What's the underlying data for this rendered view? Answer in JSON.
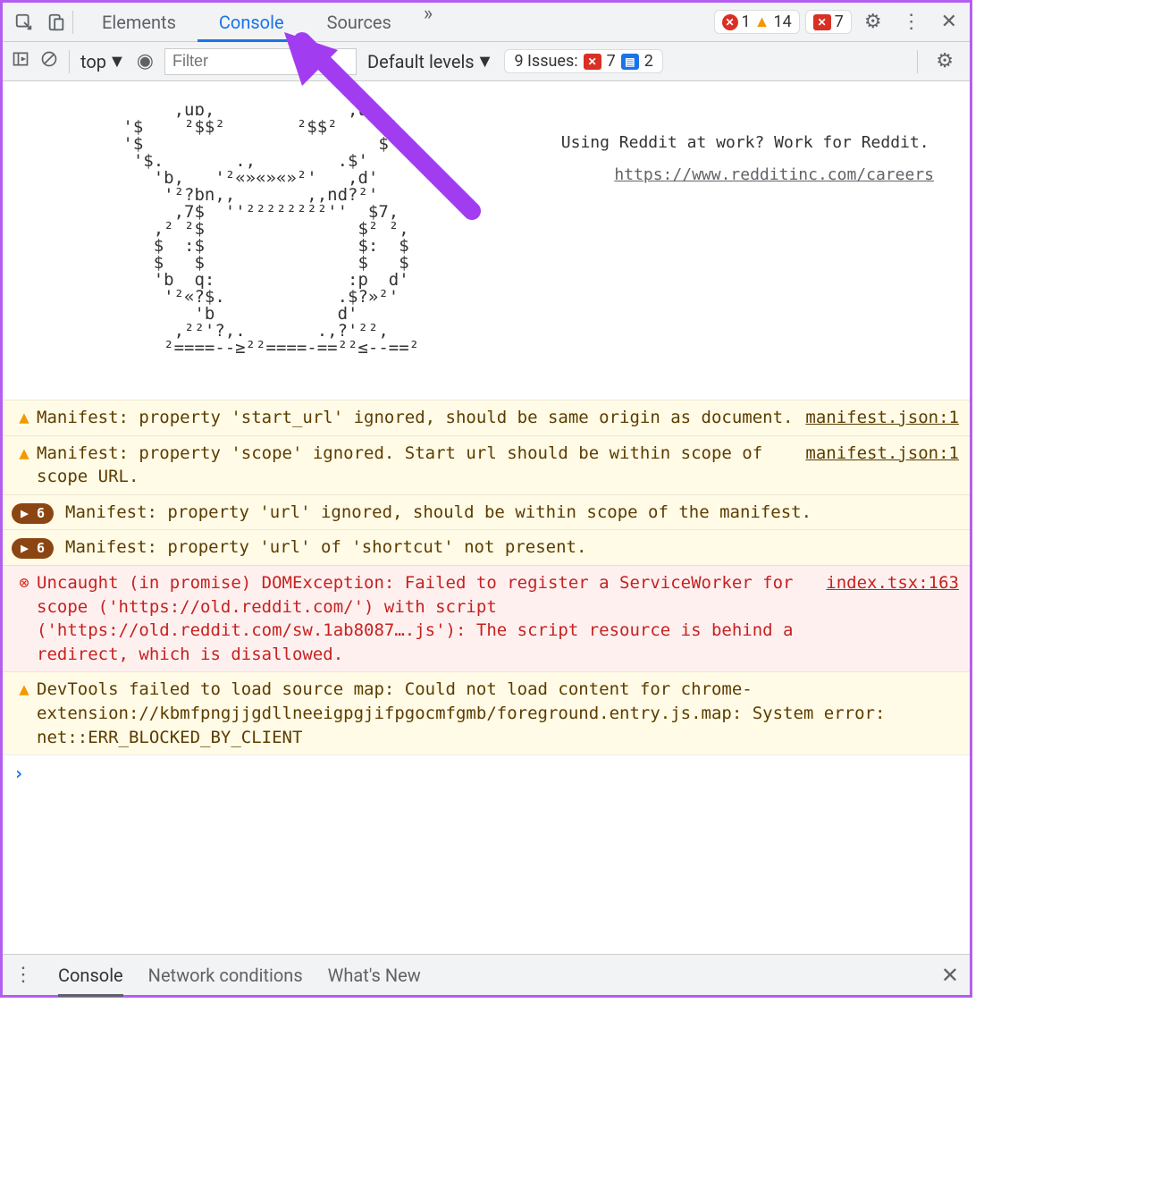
{
  "topbar": {
    "tabs": {
      "elements": "Elements",
      "console": "Console",
      "sources": "Sources"
    },
    "errors": "1",
    "warnings": "14",
    "messages": "7"
  },
  "subbar": {
    "context": "top",
    "filter_placeholder": "Filter",
    "levels": "Default levels",
    "issues_label": "9 Issues:",
    "issues_err": "7",
    "issues_info": "2"
  },
  "ascii": {
    "art": "           ,uɒ,             ,uɒ,\n          '$    ²$$²       ²$$²    $'\n          '$                       $\n           '$.       .,        .$'\n             'b,   '²«»«»«»²'   ,d'\n              '²?bn,,       ,,nd?²'\n               ,7$  ''²²²²²²²²''  $7,\n             ,² ²$               $² ²,\n             $  :$               $:  $\n             $   $               $   $\n             'b  q:             :p  d'\n              '²«?$.           .$?»²'\n                 'b            d'\n               ,²²'?,.       .,?'²²,\n              ²====--≥²²====-==²²≤--==²",
    "right_text": "Using Reddit at work? Work for Reddit.",
    "right_link": "https://www.redditinc.com/careers"
  },
  "logs": [
    {
      "type": "warn",
      "expand": "",
      "text": "Manifest: property 'start_url' ignored, should be same origin as document.",
      "src": "manifest.json:1"
    },
    {
      "type": "warn",
      "expand": "",
      "text": "Manifest: property 'scope' ignored. Start url should be within scope of scope URL.",
      "src": "manifest.json:1"
    },
    {
      "type": "warn",
      "expand": "6",
      "text": "Manifest: property 'url' ignored, should be within scope of the manifest.",
      "src": ""
    },
    {
      "type": "warn",
      "expand": "6",
      "text": "Manifest: property 'url' of 'shortcut' not present.",
      "src": ""
    },
    {
      "type": "error",
      "expand": "",
      "text": "Uncaught (in promise) DOMException: Failed to register a ServiceWorker for scope ('https://old.reddit.com/') with script ('https://old.reddit.com/sw.1ab8087….js'): The script resource is behind a redirect, which is disallowed.",
      "src": "index.tsx:163"
    },
    {
      "type": "warn",
      "expand": "",
      "text": "DevTools failed to load source map: Could not load content for chrome-extension://kbmfpngjjgdllneeigpgjifpgocmfgmb/foreground.entry.js.map: System error: net::ERR_BLOCKED_BY_CLIENT",
      "src": ""
    }
  ],
  "drawer": {
    "console": "Console",
    "network": "Network conditions",
    "whatsnew": "What's New"
  }
}
